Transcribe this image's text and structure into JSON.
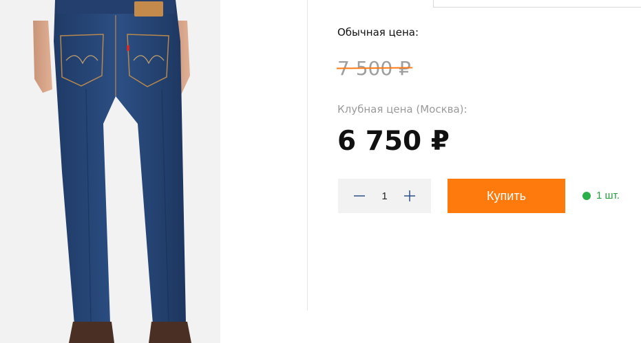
{
  "product": {
    "image_icon": "jeans-photo"
  },
  "pricing": {
    "regular_label": "Обычная цена:",
    "old_price": "7 500 ₽",
    "club_label": "Клубная цена (Москва):",
    "club_price": "6 750 ₽",
    "strike_color": "#ff7a17"
  },
  "purchase": {
    "quantity": "1",
    "decrease_icon": "minus-icon",
    "increase_icon": "plus-icon",
    "buy_label": "Купить",
    "buy_color": "#ff7a0c"
  },
  "stock": {
    "text": "1 шт.",
    "indicator_color": "#2ab048"
  }
}
